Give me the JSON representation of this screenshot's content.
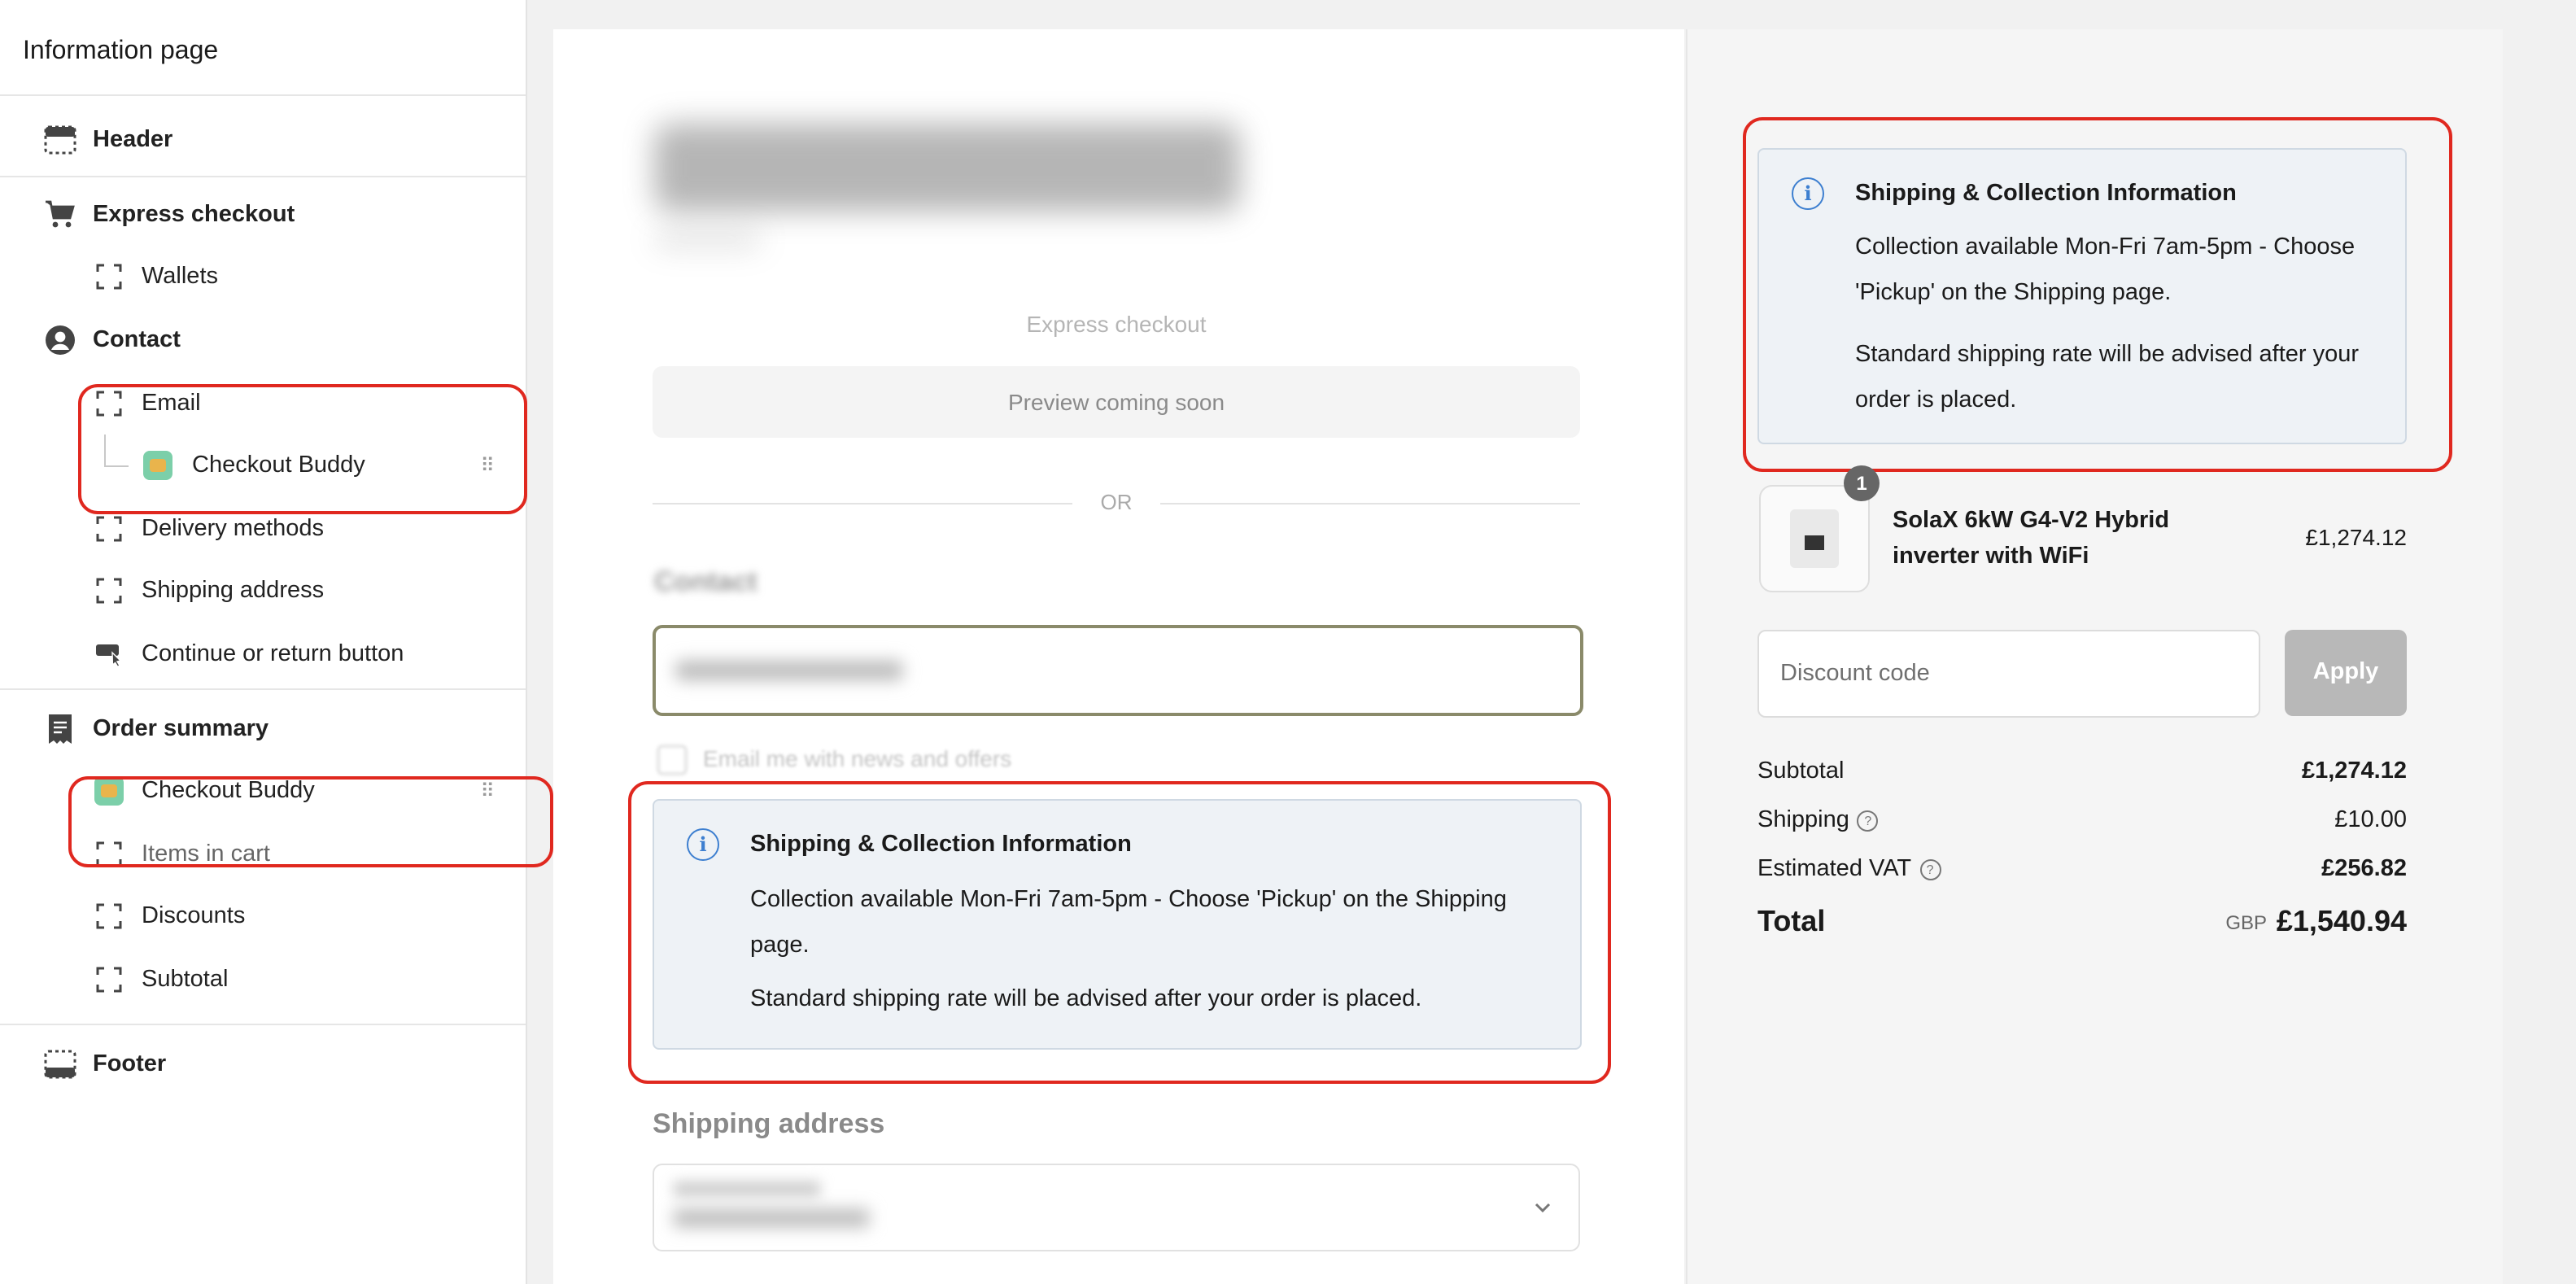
{
  "sidebar": {
    "title": "Information page",
    "header": "Header",
    "express_checkout": "Express checkout",
    "wallets": "Wallets",
    "contact": "Contact",
    "email": "Email",
    "checkout_buddy": "Checkout Buddy",
    "delivery_methods": "Delivery methods",
    "shipping_address": "Shipping address",
    "continue_or_return": "Continue or return button",
    "order_summary": "Order summary",
    "items_in_cart": "Items in cart",
    "discounts": "Discounts",
    "subtotal": "Subtotal",
    "footer": "Footer",
    "drag_handle": "⠿"
  },
  "preview": {
    "express_checkout": "Express checkout",
    "preview_coming_soon": "Preview coming soon",
    "or": "OR",
    "contact": "Contact",
    "email_opt": "Email me with news and offers",
    "shipping_address": "Shipping address",
    "info_card": {
      "title": "Shipping & Collection Information",
      "line1": "Collection available Mon-Fri 7am-5pm - Choose 'Pickup' on the Shipping page.",
      "line2": "Standard shipping rate will be advised after your order is placed."
    }
  },
  "order_summary": {
    "info_card": {
      "title": "Shipping & Collection Information",
      "line1": "Collection available Mon-Fri 7am-5pm - Choose 'Pickup' on the Shipping page.",
      "line2": "Standard shipping rate will be advised after your order is placed."
    },
    "product": {
      "quantity": "1",
      "name": "SolaX 6kW G4-V2 Hybrid inverter with WiFi",
      "price": "£1,274.12"
    },
    "discount_placeholder": "Discount code",
    "apply_label": "Apply",
    "subtotal_label": "Subtotal",
    "subtotal_value": "£1,274.12",
    "shipping_label": "Shipping",
    "shipping_value": "£10.00",
    "vat_label": "Estimated VAT",
    "vat_value": "£256.82",
    "total_label": "Total",
    "currency": "GBP",
    "total_value": "£1,540.94"
  },
  "colors": {
    "highlight_ring": "#e0281f",
    "info_icon": "#3d7fd0",
    "info_bg": "#eef2f6"
  }
}
